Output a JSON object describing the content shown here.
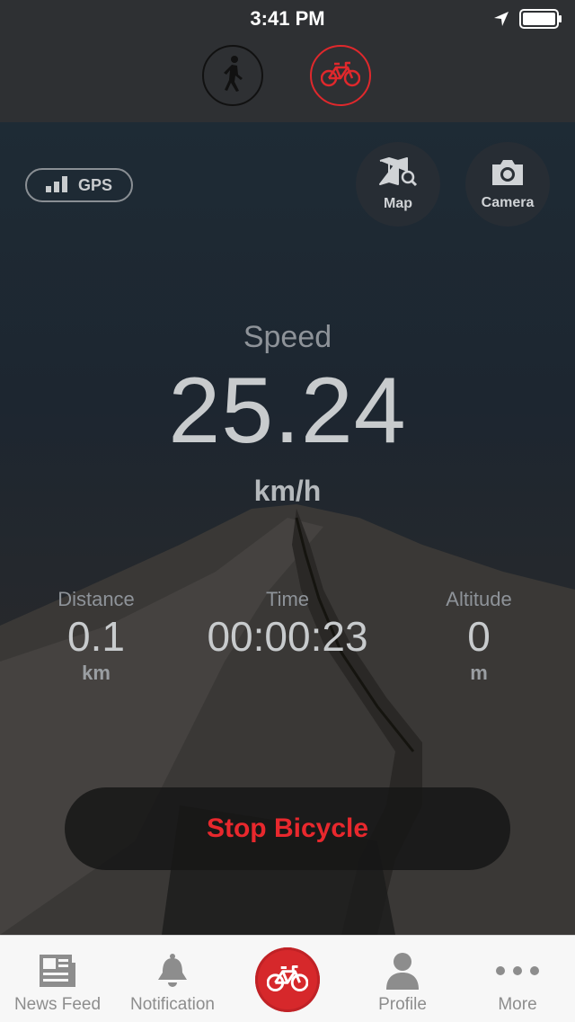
{
  "status_bar": {
    "time": "3:41 PM"
  },
  "mode_selector": {
    "modes": [
      "walk",
      "bicycle"
    ],
    "active": "bicycle"
  },
  "gps": {
    "label": "GPS"
  },
  "map_button": {
    "label": "Map"
  },
  "camera_button": {
    "label": "Camera"
  },
  "speed": {
    "label": "Speed",
    "value": "25.24",
    "unit": "km/h"
  },
  "stats": {
    "distance": {
      "label": "Distance",
      "value": "0.1",
      "unit": "km"
    },
    "time": {
      "label": "Time",
      "value": "00:00:23"
    },
    "altitude": {
      "label": "Altitude",
      "value": "0",
      "unit": "m"
    }
  },
  "stop_button": {
    "label": "Stop Bicycle"
  },
  "tab_bar": {
    "items": [
      {
        "label": "News Feed",
        "icon": "newspaper-icon"
      },
      {
        "label": "Notification",
        "icon": "bell-icon"
      },
      {
        "label": "",
        "icon": "bicycle-icon"
      },
      {
        "label": "Profile",
        "icon": "person-icon"
      },
      {
        "label": "More",
        "icon": "more-dots-icon"
      }
    ]
  },
  "colors": {
    "accent": "#e0282c",
    "header_bg": "#2e3033",
    "tab_bar_bg": "#f7f7f7",
    "tab_inactive": "#8d8d8d"
  }
}
